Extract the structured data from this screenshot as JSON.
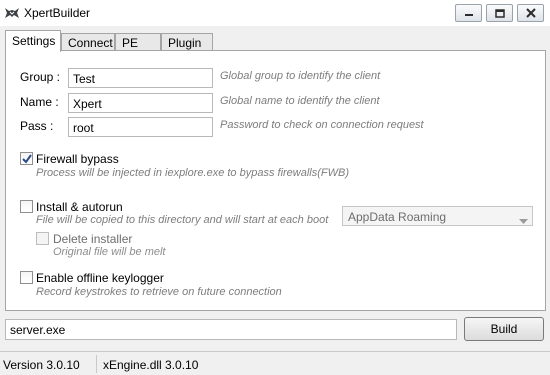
{
  "window": {
    "title": "XpertBuilder",
    "app_icon": "wolf-logo-icon",
    "controls": {
      "minimize_icon": "minimize-icon",
      "maximize_icon": "maximize-icon",
      "close_icon": "close-icon"
    }
  },
  "tabs": [
    {
      "label": "Settings",
      "active": true
    },
    {
      "label": "Connect",
      "active": false
    },
    {
      "label": "PE",
      "active": false
    },
    {
      "label": "Plugin",
      "active": false
    }
  ],
  "settings": {
    "group": {
      "label": "Group :",
      "value": "Test",
      "hint": "Global group to identify the client"
    },
    "name": {
      "label": "Name :",
      "value": "Xpert",
      "hint": "Global name to identify the client"
    },
    "pass": {
      "label": "Pass :",
      "value": "root",
      "hint": "Password to check on connection request"
    },
    "firewall": {
      "label": "Firewall bypass",
      "checked": true,
      "hint": "Process will be injected in iexplore.exe to bypass firewalls(FWB)"
    },
    "install": {
      "label": "Install & autorun",
      "checked": false,
      "hint": "File will be copied to this directory and will start at each boot",
      "location": "AppData Roaming"
    },
    "delete_installer": {
      "label": "Delete installer",
      "checked": false,
      "enabled": false,
      "hint": "Original file will be melt"
    },
    "keylogger": {
      "label": "Enable offline keylogger",
      "checked": false,
      "hint": "Record keystrokes to retrieve on future connection"
    }
  },
  "output": {
    "filename": "server.exe",
    "build_label": "Build"
  },
  "status": {
    "version": "Version 3.0.10",
    "engine": "xEngine.dll 3.0.10"
  }
}
